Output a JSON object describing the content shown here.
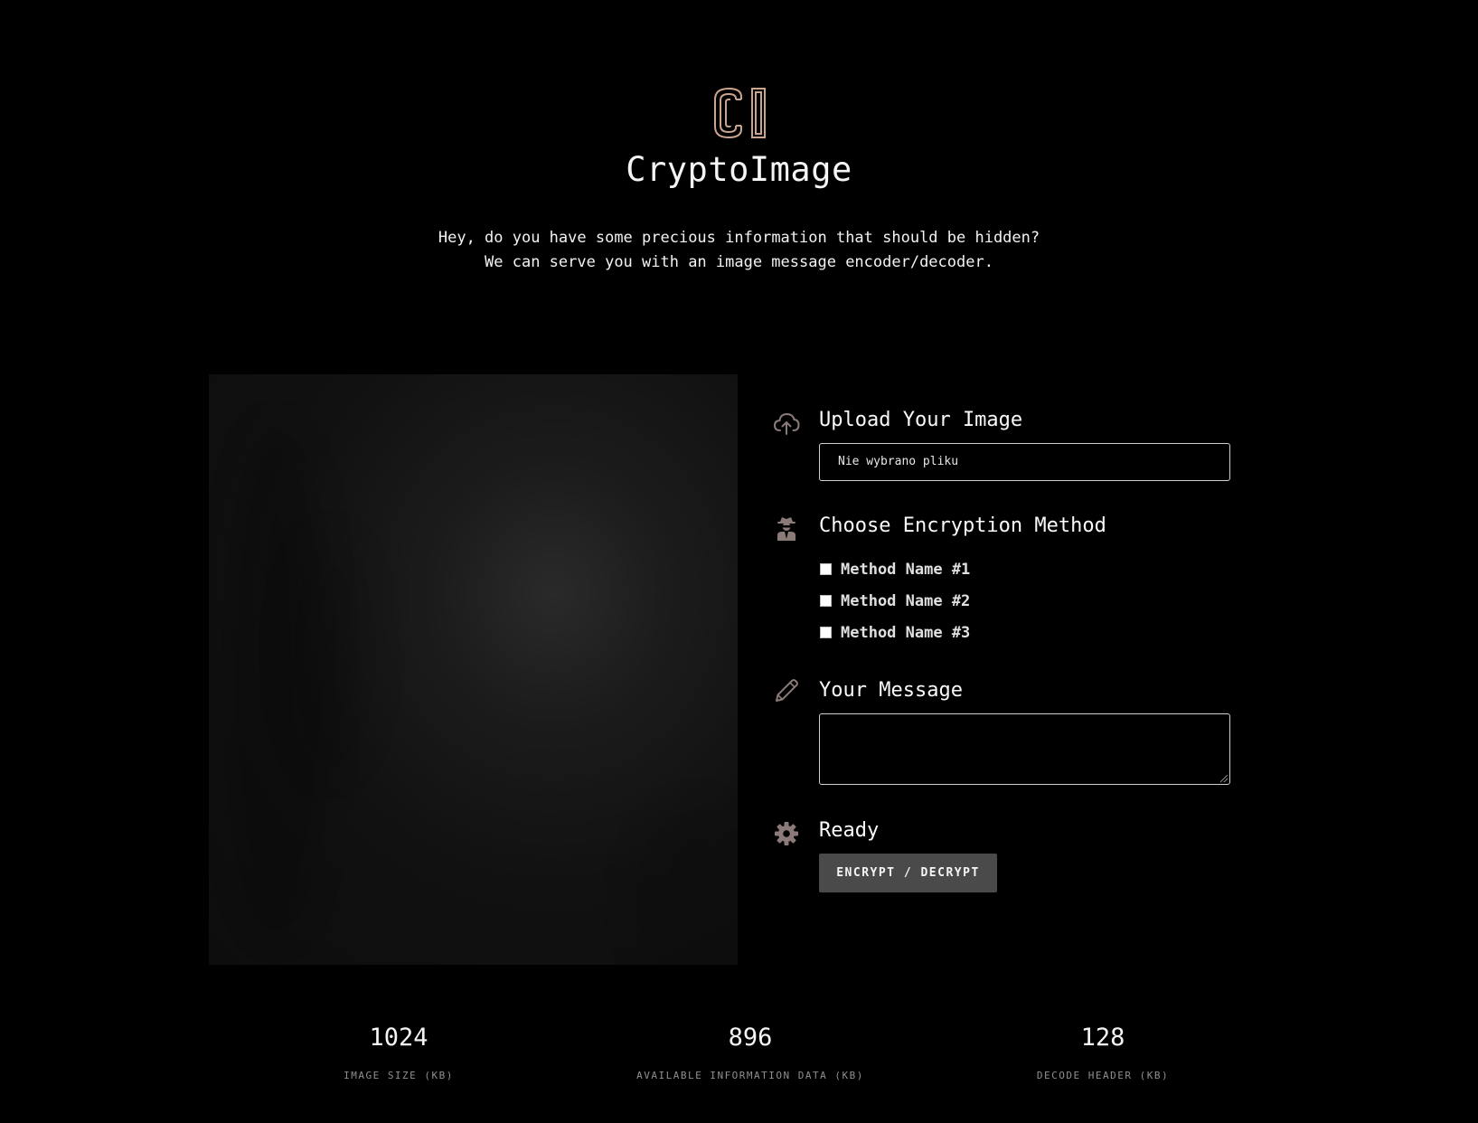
{
  "header": {
    "logo_text": "CI",
    "title": "CryptoImage",
    "intro_lines": [
      "Hey, do you have some precious information that should be hidden?",
      "We can serve you with an image message encoder/decoder."
    ]
  },
  "upload": {
    "icon": "cloud-upload-icon",
    "title": "Upload Your Image",
    "file_status": "Nie wybrano pliku"
  },
  "encryption": {
    "icon": "spy-icon",
    "title": "Choose Encryption Method",
    "methods": [
      {
        "label": "Method Name #1",
        "checked": false
      },
      {
        "label": "Method Name #2",
        "checked": false
      },
      {
        "label": "Method Name #3",
        "checked": false
      }
    ]
  },
  "message": {
    "icon": "pencil-icon",
    "title": "Your Message",
    "value": ""
  },
  "ready": {
    "icon": "gear-icon",
    "title": "Ready",
    "button_label": "ENCRYPT / DECRYPT"
  },
  "stats": [
    {
      "value": "1024",
      "label": "IMAGE SIZE (KB)"
    },
    {
      "value": "896",
      "label": "AVAILABLE INFORMATION DATA (KB)"
    },
    {
      "value": "128",
      "label": "DECODE HEADER (KB)"
    }
  ],
  "colors": {
    "background": "#000000",
    "accent": "#c9a48f",
    "icon": "#8a7a78",
    "button": "#4a4a4a"
  }
}
